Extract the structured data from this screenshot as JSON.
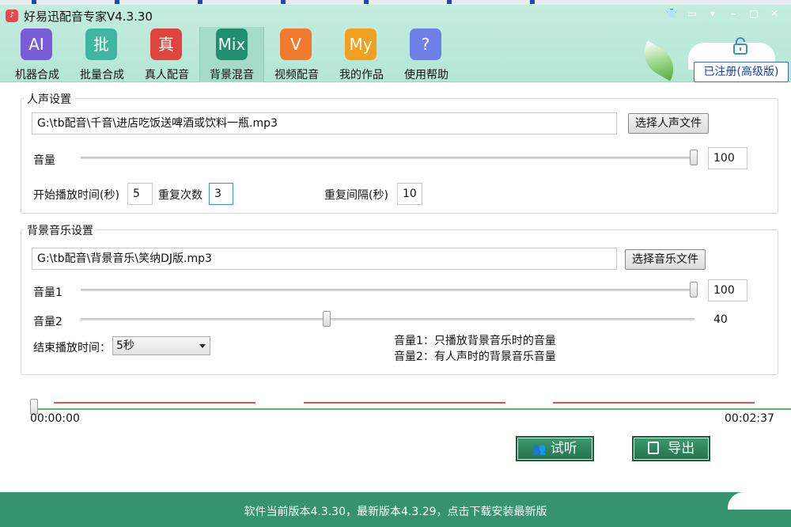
{
  "app": {
    "title": "好易迅配音专家V4.3.30",
    "icon": "music-note-icon"
  },
  "window_controls": [
    "shirt-icon",
    "message-icon",
    "dropdown-icon",
    "minimize-icon",
    "maximize-icon",
    "close-icon"
  ],
  "toolbar": [
    {
      "glyph": "AI",
      "label": "机器合成",
      "color": "#7b5cd6",
      "active": false
    },
    {
      "glyph": "批",
      "label": "批量合成",
      "color": "#3fb6a0",
      "active": false
    },
    {
      "glyph": "真",
      "label": "真人配音",
      "color": "#e0443f",
      "active": false
    },
    {
      "glyph": "Mix",
      "label": "背景混音",
      "color": "#1f8f6e",
      "active": true
    },
    {
      "glyph": "V",
      "label": "视频配音",
      "color": "#f07a2e",
      "active": false
    },
    {
      "glyph": "My",
      "label": "我的作品",
      "color": "#f0a11f",
      "active": false
    },
    {
      "glyph": "?",
      "label": "使用帮助",
      "color": "#6f7fe8",
      "active": false
    }
  ],
  "registration": {
    "label": "已注册(高级版)"
  },
  "voice": {
    "group_title": "人声设置",
    "file_path": "G:\\tb配音\\千音\\进店吃饭送啤酒或饮料一瓶.mp3",
    "choose_button": "选择人声文件",
    "volume_label": "音量",
    "volume_value": "100",
    "volume_fraction": 1.0,
    "start_label": "开始播放时间(秒)",
    "start_value": "5",
    "repeat_label": "重复次数",
    "repeat_value": "3",
    "interval_label": "重复间隔(秒)",
    "interval_value": "10"
  },
  "bgm": {
    "group_title": "背景音乐设置",
    "file_path": "G:\\tb配音\\背景音乐\\笑纳DJ版.mp3",
    "choose_button": "选择音乐文件",
    "volume1_label": "音量1",
    "volume1_value": "100",
    "volume1_fraction": 1.0,
    "volume2_label": "音量2",
    "volume2_value": "40",
    "volume2_fraction": 0.4,
    "end_label": "结束播放时间：",
    "end_value": "5秒",
    "note1": "音量1：只播放背景音乐时的音量",
    "note2": "音量2：有人声时的背景音乐音量"
  },
  "timeline": {
    "start_time": "00:00:00",
    "end_time": "00:02:37",
    "position_fraction": 0.0
  },
  "actions": {
    "preview_label": "试听",
    "export_label": "导出"
  },
  "footer": {
    "text": "软件当前版本4.3.30，最新版本4.3.29，点击下载安装最新版"
  },
  "colors": {
    "header_bg": "#c4ecdf",
    "accent_green": "#35946f",
    "timeline_green": "#5cb36b",
    "segment_red": "#e05050"
  }
}
